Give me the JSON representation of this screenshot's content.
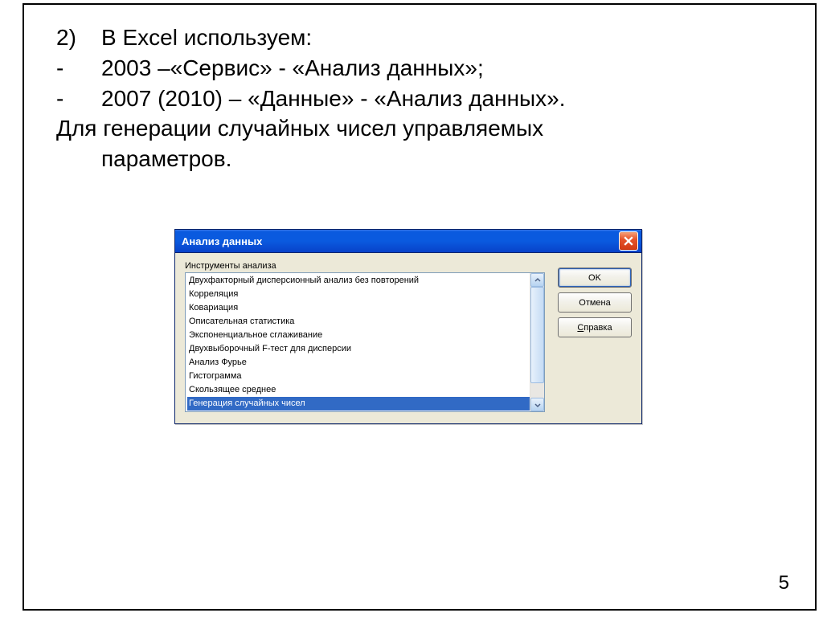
{
  "text": {
    "line1_num": "2)",
    "line1": "В Excel используем:",
    "line2": "2003 –«Сервис» - «Анализ данных»;",
    "line3": "2007 (2010) – «Данные» - «Анализ данных».",
    "line4": "Для генерации случайных чисел управляемых",
    "line5": "параметров."
  },
  "dialog": {
    "title": "Анализ данных",
    "group_label": "Инструменты анализа",
    "items": [
      "Двухфакторный дисперсионный анализ без повторений",
      "Корреляция",
      "Ковариация",
      "Описательная статистика",
      "Экспоненциальное сглаживание",
      "Двухвыборочный F-тест для дисперсии",
      "Анализ Фурье",
      "Гистограмма",
      "Скользящее среднее",
      "Генерация случайных чисел"
    ],
    "selected_index": 9,
    "buttons": {
      "ok": "OK",
      "cancel": "Отмена",
      "help_prefix": "С",
      "help_rest": "правка"
    }
  },
  "page_number": "5"
}
